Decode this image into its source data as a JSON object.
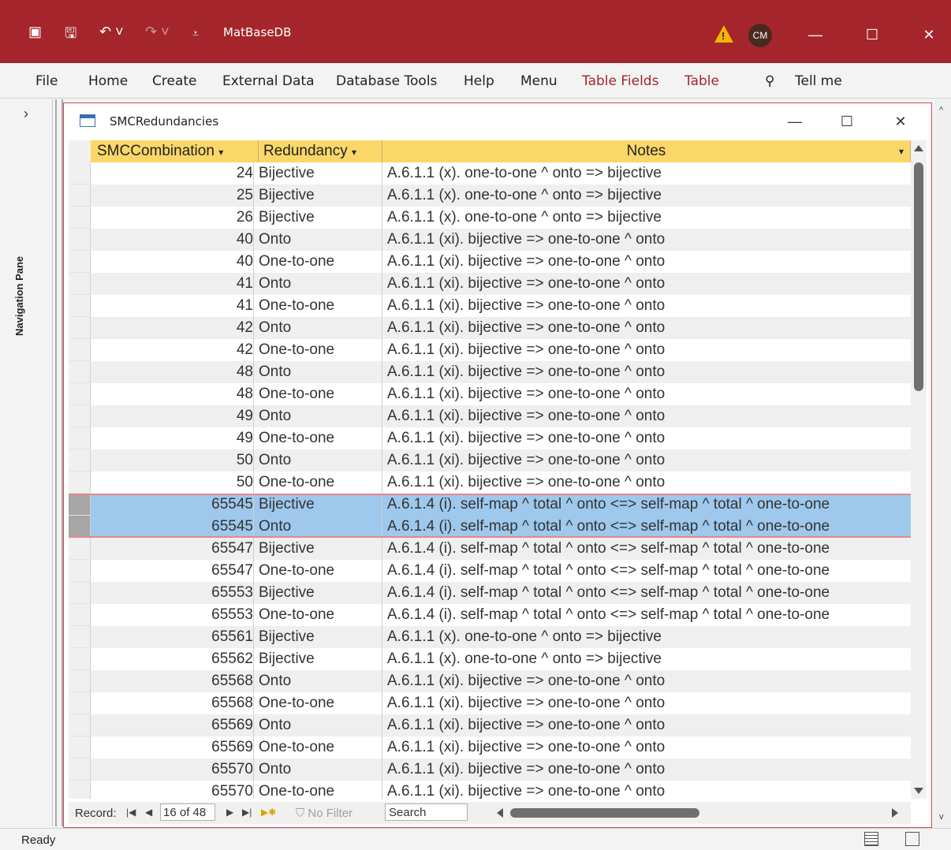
{
  "window": {
    "title": "MatBaseDB",
    "user_initials": "CM"
  },
  "ribbon": {
    "tabs": [
      "File",
      "Home",
      "Create",
      "External Data",
      "Database Tools",
      "Help",
      "Menu",
      "Table Fields",
      "Table"
    ],
    "tell_me": "Tell me"
  },
  "nav_pane": {
    "label": "Navigation Pane"
  },
  "document": {
    "title": "SMCRedundancies"
  },
  "columns": [
    "SMCCombination",
    "Redundancy",
    "Notes"
  ],
  "rows": [
    [
      "24",
      "Bijective",
      "A.6.1.1 (x). one-to-one ^ onto => bijective"
    ],
    [
      "25",
      "Bijective",
      "A.6.1.1 (x). one-to-one ^ onto => bijective"
    ],
    [
      "26",
      "Bijective",
      "A.6.1.1 (x). one-to-one ^ onto => bijective"
    ],
    [
      "40",
      "Onto",
      "A.6.1.1 (xi). bijective => one-to-one ^  onto"
    ],
    [
      "40",
      "One-to-one",
      "A.6.1.1 (xi). bijective => one-to-one ^  onto"
    ],
    [
      "41",
      "Onto",
      "A.6.1.1 (xi). bijective => one-to-one ^  onto"
    ],
    [
      "41",
      "One-to-one",
      "A.6.1.1 (xi). bijective => one-to-one ^  onto"
    ],
    [
      "42",
      "Onto",
      "A.6.1.1 (xi). bijective => one-to-one ^  onto"
    ],
    [
      "42",
      "One-to-one",
      "A.6.1.1 (xi). bijective => one-to-one ^  onto"
    ],
    [
      "48",
      "Onto",
      "A.6.1.1 (xi). bijective => one-to-one ^  onto"
    ],
    [
      "48",
      "One-to-one",
      "A.6.1.1 (xi). bijective => one-to-one ^  onto"
    ],
    [
      "49",
      "Onto",
      "A.6.1.1 (xi). bijective => one-to-one ^  onto"
    ],
    [
      "49",
      "One-to-one",
      "A.6.1.1 (xi). bijective => one-to-one ^  onto"
    ],
    [
      "50",
      "Onto",
      "A.6.1.1 (xi). bijective => one-to-one ^  onto"
    ],
    [
      "50",
      "One-to-one",
      "A.6.1.1 (xi). bijective => one-to-one ^  onto"
    ],
    [
      "65545",
      "Bijective",
      "A.6.1.4 (i). self-map ^ total ^ onto <=> self-map ^ total ^ one-to-one"
    ],
    [
      "65545",
      "Onto",
      "A.6.1.4 (i). self-map ^ total ^ onto <=> self-map ^ total ^ one-to-one"
    ],
    [
      "65547",
      "Bijective",
      "A.6.1.4 (i). self-map ^ total ^ onto <=> self-map ^ total ^ one-to-one"
    ],
    [
      "65547",
      "One-to-one",
      "A.6.1.4 (i). self-map ^ total ^ onto <=> self-map ^ total ^ one-to-one"
    ],
    [
      "65553",
      "Bijective",
      "A.6.1.4 (i). self-map ^ total ^ onto <=> self-map ^ total ^ one-to-one"
    ],
    [
      "65553",
      "One-to-one",
      "A.6.1.4 (i). self-map ^ total ^ onto <=> self-map ^ total ^ one-to-one"
    ],
    [
      "65561",
      "Bijective",
      "A.6.1.1 (x). one-to-one ^ onto => bijective"
    ],
    [
      "65562",
      "Bijective",
      "A.6.1.1 (x). one-to-one ^ onto => bijective"
    ],
    [
      "65568",
      "Onto",
      "A.6.1.1 (xi). bijective => one-to-one ^  onto"
    ],
    [
      "65568",
      "One-to-one",
      "A.6.1.1 (xi). bijective => one-to-one ^  onto"
    ],
    [
      "65569",
      "Onto",
      "A.6.1.1 (xi). bijective => one-to-one ^  onto"
    ],
    [
      "65569",
      "One-to-one",
      "A.6.1.1 (xi). bijective => one-to-one ^  onto"
    ],
    [
      "65570",
      "Onto",
      "A.6.1.1 (xi). bijective => one-to-one ^  onto"
    ],
    [
      "65570",
      "One-to-one",
      "A.6.1.1 (xi). bijective => one-to-one ^  onto"
    ]
  ],
  "selected_rows": [
    15,
    16
  ],
  "record_nav": {
    "label": "Record:",
    "position": "16 of 48",
    "filter": "No Filter",
    "search": "Search"
  },
  "status": {
    "text": "Ready"
  },
  "colors": {
    "title_bar": "#a4262c",
    "header": "#fad768",
    "selection": "#9ec8ec"
  }
}
